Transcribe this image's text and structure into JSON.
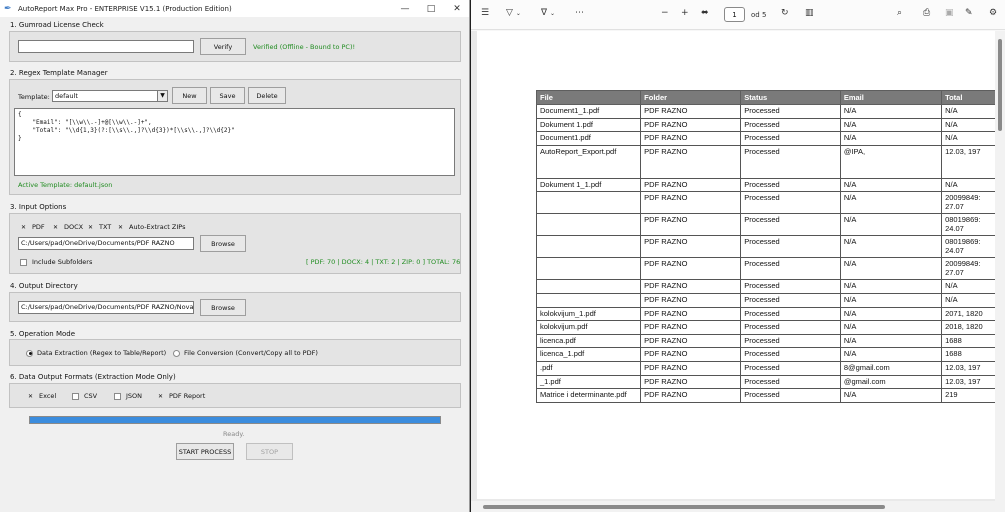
{
  "app": {
    "window_title": "AutoReport Max Pro - ENTERPRISE V15.1 (Production Edition)",
    "license": {
      "frame_title": "1. Gumroad License Check",
      "key_value": "",
      "verify_label": "Verify",
      "status": "Verified (Offline - Bound to PC)!"
    },
    "regex": {
      "frame_title": "2. Regex Template Manager",
      "template_label": "Template:",
      "template_value": "default",
      "new_label": "New",
      "save_label": "Save",
      "delete_label": "Delete",
      "editor_text": "{\n    \"Email\": \"[\\\\w\\\\.-]+@[\\\\w\\\\.-]+\",\n    \"Total\": \"\\\\d{1,3}(?:[\\\\s\\\\.,]?\\\\d{3})*[\\\\s\\\\.,]?\\\\d{2}\"\n}",
      "active_template": "Active Template: default.json"
    },
    "input": {
      "frame_title": "3. Input Options",
      "checks": [
        {
          "label": "PDF",
          "checked": true
        },
        {
          "label": "DOCX",
          "checked": true
        },
        {
          "label": "TXT",
          "checked": true
        },
        {
          "label": "Auto-Extract ZIPs",
          "checked": true
        }
      ],
      "path": "C:/Users/pad/OneDrive/Documents/PDF RAZNO",
      "browse_label": "Browse",
      "subfolders_label": "Include Subfolders",
      "counts": "[ PDF: 70 | DOCX: 4 | TXT: 2 | ZIP: 0 ]  TOTAL: 76"
    },
    "output": {
      "frame_title": "4. Output Directory",
      "path": "C:/Users/pad/OneDrive/Documents/PDF RAZNO/Nova fa",
      "browse_label": "Browse"
    },
    "mode": {
      "frame_title": "5. Operation Mode",
      "extraction_label": "Data Extraction (Regex to Table/Report)",
      "conversion_label": "File Conversion (Convert/Copy all to PDF)",
      "selected": "extraction"
    },
    "formats": {
      "frame_title": "6. Data Output Formats (Extraction Mode Only)",
      "items": [
        {
          "label": "Excel",
          "checked": true
        },
        {
          "label": "CSV",
          "checked": false
        },
        {
          "label": "JSON",
          "checked": false
        },
        {
          "label": "PDF Report",
          "checked": true
        }
      ]
    },
    "progress": 1.0,
    "status": "Ready.",
    "start_label": "START PROCESS",
    "stop_label": "STOP"
  },
  "viewer": {
    "page_current": "1",
    "page_total": "od 5",
    "table": {
      "headers": [
        "File",
        "Folder",
        "Status",
        "Email",
        "Total"
      ],
      "rows": [
        [
          "Document1_1.pdf",
          "PDF RAZNO",
          "Processed",
          "N/A",
          "N/A"
        ],
        [
          "Dokument 1.pdf",
          "PDF RAZNO",
          "Processed",
          "N/A",
          "N/A"
        ],
        [
          "Document1.pdf",
          "PDF RAZNO",
          "Processed",
          "N/A",
          "N/A"
        ],
        [
          "AutoReport_Export.pdf",
          "PDF RAZNO",
          "Processed",
          "@IPA,",
          "12.03, 197"
        ],
        [
          "Dokument 1_1.pdf",
          "PDF RAZNO",
          "Processed",
          "N/A",
          "N/A"
        ],
        [
          "",
          "PDF RAZNO",
          "Processed",
          "N/A",
          "20099849: 27.07"
        ],
        [
          "",
          "PDF RAZNO",
          "Processed",
          "N/A",
          "08019869: 24.07"
        ],
        [
          "",
          "PDF RAZNO",
          "Processed",
          "N/A",
          "08019869: 24.07"
        ],
        [
          "",
          "PDF RAZNO",
          "Processed",
          "N/A",
          "20099849: 27.07"
        ],
        [
          "",
          "PDF RAZNO",
          "Processed",
          "N/A",
          "N/A"
        ],
        [
          "",
          "PDF RAZNO",
          "Processed",
          "N/A",
          "N/A"
        ],
        [
          "kolokvijum_1.pdf",
          "PDF RAZNO",
          "Processed",
          "N/A",
          "2071, 1820"
        ],
        [
          "kolokvijum.pdf",
          "PDF RAZNO",
          "Processed",
          "N/A",
          "2018, 1820"
        ],
        [
          "licenca.pdf",
          "PDF RAZNO",
          "Processed",
          "N/A",
          "1688"
        ],
        [
          "licenca_1.pdf",
          "PDF RAZNO",
          "Processed",
          "N/A",
          "1688"
        ],
        [
          ".pdf",
          "PDF RAZNO",
          "Processed",
          "8@gmail.com",
          "12.03, 197"
        ],
        [
          "_1.pdf",
          "PDF RAZNO",
          "Processed",
          "@gmail.com",
          "12.03, 197"
        ],
        [
          "Matrice i determinante.pdf",
          "PDF RAZNO",
          "Processed",
          "N/A",
          "219"
        ]
      ]
    }
  }
}
